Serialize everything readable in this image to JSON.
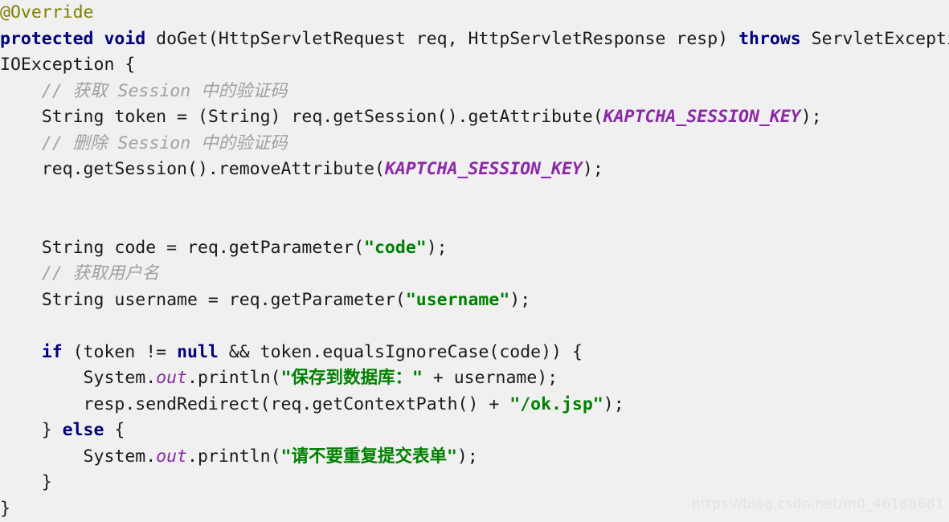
{
  "editor": {
    "language": "java",
    "background_color": "#f0f0f0",
    "default_text_color": "#1a1a1a",
    "token_colors": {
      "keyword": "#000080",
      "annotation": "#808000",
      "comment": "#a0a0a0",
      "string": "#008000",
      "static_field": "#8c28a8",
      "plain": "#1a1a1a"
    }
  },
  "code": {
    "lines": [
      {
        "index": 1,
        "text": "@Override",
        "tokens": [
          {
            "t": "@Override",
            "k": "annot"
          }
        ]
      },
      {
        "index": 2,
        "text": "protected void doGet(HttpServletRequest req, HttpServletResponse resp) throws ServletException,",
        "tokens": [
          {
            "t": "protected",
            "k": "keyword"
          },
          {
            "t": " ",
            "k": "plain"
          },
          {
            "t": "void",
            "k": "keyword"
          },
          {
            "t": " doGet(HttpServletRequest req, HttpServletResponse resp) ",
            "k": "plain"
          },
          {
            "t": "throws",
            "k": "keyword"
          },
          {
            "t": " ServletException,",
            "k": "plain"
          }
        ]
      },
      {
        "index": 3,
        "text": "IOException {",
        "tokens": [
          {
            "t": "IOException {",
            "k": "plain"
          }
        ]
      },
      {
        "index": 4,
        "text": "    // 获取 Session 中的验证码",
        "tokens": [
          {
            "t": "    ",
            "k": "plain"
          },
          {
            "t": "// 获取 Session 中的验证码",
            "k": "comment"
          }
        ]
      },
      {
        "index": 5,
        "text": "    String token = (String) req.getSession().getAttribute(KAPTCHA_SESSION_KEY);",
        "tokens": [
          {
            "t": "    String token = (String) req.getSession().getAttribute(",
            "k": "plain"
          },
          {
            "t": "KAPTCHA_SESSION_KEY",
            "k": "static"
          },
          {
            "t": ");",
            "k": "plain"
          }
        ]
      },
      {
        "index": 6,
        "text": "    // 删除 Session 中的验证码",
        "tokens": [
          {
            "t": "    ",
            "k": "plain"
          },
          {
            "t": "// 删除 Session 中的验证码",
            "k": "comment"
          }
        ]
      },
      {
        "index": 7,
        "text": "    req.getSession().removeAttribute(KAPTCHA_SESSION_KEY);",
        "tokens": [
          {
            "t": "    req.getSession().removeAttribute(",
            "k": "plain"
          },
          {
            "t": "KAPTCHA_SESSION_KEY",
            "k": "static"
          },
          {
            "t": ");",
            "k": "plain"
          }
        ]
      },
      {
        "index": 8,
        "text": "",
        "tokens": []
      },
      {
        "index": 9,
        "text": "",
        "tokens": []
      },
      {
        "index": 10,
        "text": "    String code = req.getParameter(\"code\");",
        "tokens": [
          {
            "t": "    String code = req.getParameter(",
            "k": "plain"
          },
          {
            "t": "\"code\"",
            "k": "string"
          },
          {
            "t": ");",
            "k": "plain"
          }
        ]
      },
      {
        "index": 11,
        "text": "    // 获取用户名",
        "tokens": [
          {
            "t": "    ",
            "k": "plain"
          },
          {
            "t": "// 获取用户名",
            "k": "comment"
          }
        ]
      },
      {
        "index": 12,
        "text": "    String username = req.getParameter(\"username\");",
        "tokens": [
          {
            "t": "    String username = req.getParameter(",
            "k": "plain"
          },
          {
            "t": "\"username\"",
            "k": "string"
          },
          {
            "t": ");",
            "k": "plain"
          }
        ]
      },
      {
        "index": 13,
        "text": "",
        "tokens": []
      },
      {
        "index": 14,
        "text": "    if (token != null && token.equalsIgnoreCase(code)) {",
        "tokens": [
          {
            "t": "    ",
            "k": "plain"
          },
          {
            "t": "if",
            "k": "keyword"
          },
          {
            "t": " (token != ",
            "k": "plain"
          },
          {
            "t": "null",
            "k": "keyword"
          },
          {
            "t": " && token.equalsIgnoreCase(code)) {",
            "k": "plain"
          }
        ]
      },
      {
        "index": 15,
        "text": "        System.out.println(\"保存到数据库：\" + username);",
        "tokens": [
          {
            "t": "        System.",
            "k": "plain"
          },
          {
            "t": "out",
            "k": "field"
          },
          {
            "t": ".println(",
            "k": "plain"
          },
          {
            "t": "\"保存到数据库：\"",
            "k": "string"
          },
          {
            "t": " + username);",
            "k": "plain"
          }
        ]
      },
      {
        "index": 16,
        "text": "        resp.sendRedirect(req.getContextPath() + \"/ok.jsp\");",
        "tokens": [
          {
            "t": "        resp.sendRedirect(req.getContextPath() + ",
            "k": "plain"
          },
          {
            "t": "\"/ok.jsp\"",
            "k": "string"
          },
          {
            "t": ");",
            "k": "plain"
          }
        ]
      },
      {
        "index": 17,
        "text": "    } else {",
        "tokens": [
          {
            "t": "    } ",
            "k": "plain"
          },
          {
            "t": "else",
            "k": "keyword"
          },
          {
            "t": " {",
            "k": "plain"
          }
        ]
      },
      {
        "index": 18,
        "text": "        System.out.println(\"请不要重复提交表单\");",
        "tokens": [
          {
            "t": "        System.",
            "k": "plain"
          },
          {
            "t": "out",
            "k": "field"
          },
          {
            "t": ".println(",
            "k": "plain"
          },
          {
            "t": "\"请不要重复提交表单\"",
            "k": "string"
          },
          {
            "t": ");",
            "k": "plain"
          }
        ]
      },
      {
        "index": 19,
        "text": "    }",
        "tokens": [
          {
            "t": "    }",
            "k": "plain"
          }
        ]
      },
      {
        "index": 20,
        "text": "}",
        "tokens": [
          {
            "t": "}",
            "k": "plain"
          }
        ]
      }
    ]
  },
  "watermark": {
    "text": "https://blog.csdn.net/m0_46188681",
    "color": "#e2e2e2"
  }
}
